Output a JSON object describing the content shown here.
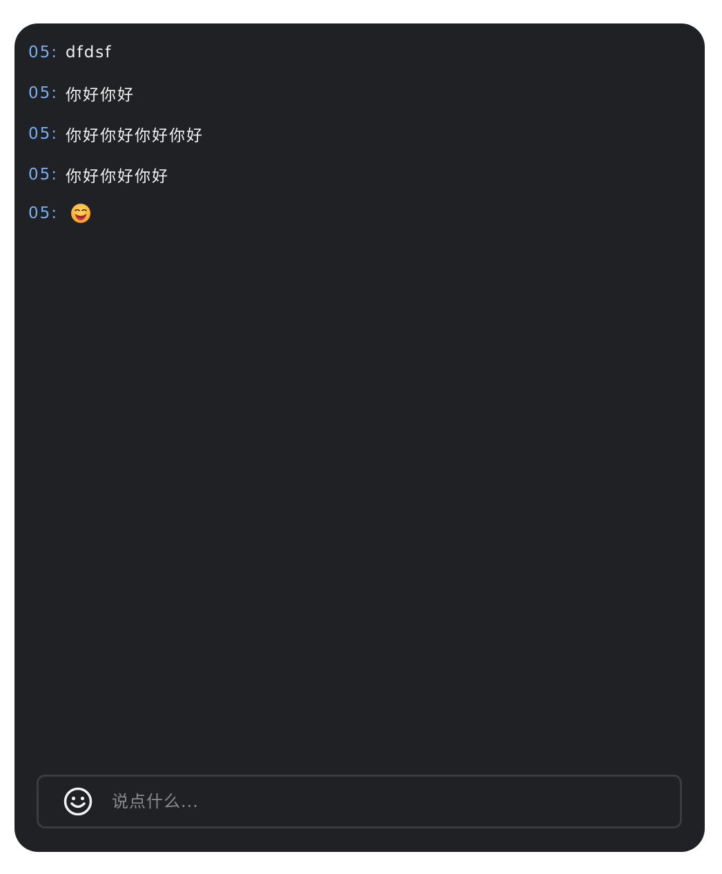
{
  "messages": [
    {
      "prefix": "05:",
      "text": "dfdsf"
    },
    {
      "prefix": "05:",
      "text": "你好你好"
    },
    {
      "prefix": "05:",
      "text": "你好你好你好你好"
    },
    {
      "prefix": "05:",
      "text": "你好你好你好"
    },
    {
      "prefix": "05:",
      "emoji": "savoring-food-emoji"
    }
  ],
  "composer": {
    "placeholder": "说点什么...",
    "emoji_button_icon": "smiley-face-icon"
  },
  "colors": {
    "panel_bg": "#202124",
    "prefix": "#79aef2",
    "text": "#f2f2f2",
    "placeholder": "#8a8b8f",
    "border": "#3b3c40"
  }
}
